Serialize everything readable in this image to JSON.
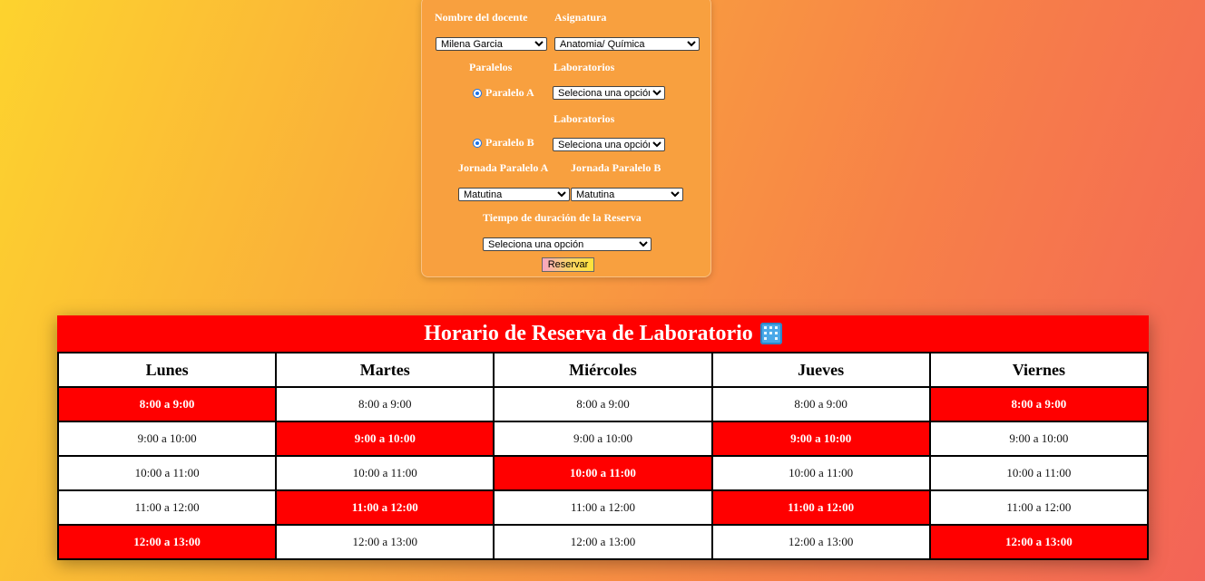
{
  "form": {
    "docente_label": "Nombre del docente",
    "asignatura_label": "Asignatura",
    "docente_value": "Milena Garcia",
    "asignatura_value": "Anatomia/ Química",
    "paralelos_label": "Paralelos",
    "laboratorios_label_a": "Laboratorios",
    "paralelo_a_label": "Paralelo A",
    "lab_a_value": "Seleciona una opción",
    "laboratorios_label_b": "Laboratorios",
    "paralelo_b_label": "Paralelo B",
    "lab_b_value": "Seleciona una opción",
    "jornada_a_label": "Jornada Paralelo A",
    "jornada_b_label": "Jornada Paralelo B",
    "jornada_a_value": "Matutina",
    "jornada_b_value": "Matutina",
    "tiempo_label": "Tiempo de duración de la Reserva",
    "tiempo_value": "Seleciona una opción",
    "reservar_label": "Reservar"
  },
  "schedule": {
    "title": "Horario de Reserva de Laboratorio",
    "title_icon": "office-building-icon",
    "reserved_color": "#ff0000",
    "days": [
      "Lunes",
      "Martes",
      "Miércoles",
      "Jueves",
      "Viernes"
    ],
    "rows": [
      [
        "8:00 a 9:00",
        "8:00 a 9:00",
        "8:00 a 9:00",
        "8:00 a 9:00",
        "8:00 a 9:00"
      ],
      [
        "9:00 a 10:00",
        "9:00 a 10:00",
        "9:00 a 10:00",
        "9:00 a 10:00",
        "9:00 a 10:00"
      ],
      [
        "10:00 a 11:00",
        "10:00 a 11:00",
        "10:00 a 11:00",
        "10:00 a 11:00",
        "10:00 a 11:00"
      ],
      [
        "11:00 a 12:00",
        "11:00 a 12:00",
        "11:00 a 12:00",
        "11:00 a 12:00",
        "11:00 a 12:00"
      ],
      [
        "12:00 a 13:00",
        "12:00 a 13:00",
        "12:00 a 13:00",
        "12:00 a 13:00",
        "12:00 a 13:00"
      ]
    ],
    "reserved": [
      [
        true,
        false,
        false,
        false,
        true
      ],
      [
        false,
        true,
        false,
        true,
        false
      ],
      [
        false,
        false,
        true,
        false,
        false
      ],
      [
        false,
        true,
        false,
        true,
        false
      ],
      [
        true,
        false,
        false,
        false,
        true
      ]
    ]
  }
}
